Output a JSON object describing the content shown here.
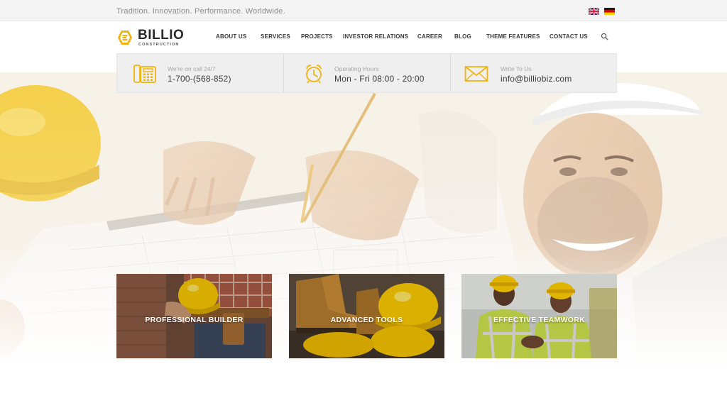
{
  "topbar": {
    "tagline": "Tradition. Innovation. Performance. Worldwide.",
    "languages": [
      {
        "code": "en",
        "icon": "uk-flag-icon"
      },
      {
        "code": "de",
        "icon": "germany-flag-icon"
      }
    ]
  },
  "brand": {
    "name": "BILLIO",
    "subtitle": "CONSTRUCTION",
    "accent_color": "#f0b30f"
  },
  "nav": {
    "items": [
      "ABOUT US",
      "SERVICES",
      "PROJECTS",
      "INVESTOR RELATIONS",
      "CAREER",
      "BLOG",
      "THEME FEATURES",
      "CONTACT US"
    ],
    "search_icon": "search-icon"
  },
  "infobar": {
    "items": [
      {
        "icon": "phone-icon",
        "label": "We're on call 24/7",
        "value": "1-700-(568-852)"
      },
      {
        "icon": "alarm-clock-icon",
        "label": "Operating Hours",
        "value": "Mon - Fri 08:00 - 20:00"
      },
      {
        "icon": "envelope-icon",
        "label": "Write To Us",
        "value": "info@billiobiz.com"
      }
    ]
  },
  "features": [
    {
      "label": "PROFESSIONAL BUILDER"
    },
    {
      "label": "ADVANCED TOOLS"
    },
    {
      "label": "EFFECTIVE TEAMWORK"
    }
  ]
}
